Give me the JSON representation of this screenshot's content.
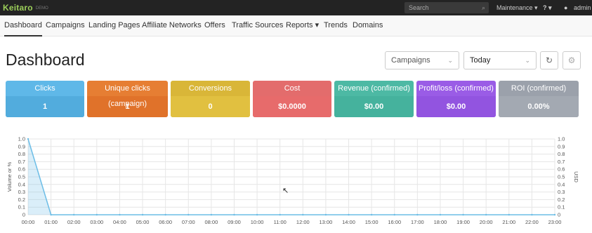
{
  "topbar": {
    "logo": "Keitaro",
    "logo_sub": "DEMO",
    "search_placeholder": "Search",
    "maintenance": "Maintenance ▾",
    "help": "? ▾",
    "user": "admin"
  },
  "nav": {
    "items": [
      "Dashboard",
      "Campaigns",
      "Landing Pages",
      "Affiliate Networks",
      "Offers",
      "Traffic Sources",
      "Reports ▾",
      "Trends",
      "Domains"
    ]
  },
  "page": {
    "title": "Dashboard",
    "filter_select": "Campaigns",
    "period_select": "Today"
  },
  "cards": [
    {
      "label": "Clicks",
      "value": "1",
      "color": "#5fb8e8",
      "val_color": "#52acdd"
    },
    {
      "label": "Unique clicks (campaign)",
      "value": "1",
      "color": "#e67e33",
      "val_color": "#e0722a"
    },
    {
      "label": "Conversions",
      "value": "0",
      "color": "#d9b638",
      "val_color": "#e1c040"
    },
    {
      "label": "Cost",
      "value": "$0.0000",
      "color": "#e36c6c",
      "val_color": "#e76b6b"
    },
    {
      "label": "Revenue (confirmed)",
      "value": "$0.00",
      "color": "#4db9a4",
      "val_color": "#45b29d"
    },
    {
      "label": "Profit/loss (confirmed)",
      "value": "$0.00",
      "color": "#9a5ce6",
      "val_color": "#9254e0"
    },
    {
      "label": "ROI (confirmed)",
      "value": "0.00%",
      "color": "#9ba1ab",
      "val_color": "#a3a9b2"
    }
  ],
  "chart_data": {
    "type": "area",
    "ylabel_left": "Volume or %",
    "ylabel_right": "USD",
    "y_ticks": [
      "0",
      "0.1",
      "0.2",
      "0.3",
      "0.4",
      "0.5",
      "0.6",
      "0.7",
      "0.8",
      "0.9",
      "1.0"
    ],
    "y_ticks_right": [
      "0",
      "0.1",
      "0.2",
      "0.3",
      "0.4",
      "0.5",
      "0.6",
      "0.7",
      "0.8",
      "0.9",
      "1.0"
    ],
    "ylim": [
      0,
      1
    ],
    "x": [
      "00:00",
      "01:00",
      "02:00",
      "03:00",
      "04:00",
      "05:00",
      "06:00",
      "07:00",
      "08:00",
      "09:00",
      "10:00",
      "11:00",
      "12:00",
      "13:00",
      "14:00",
      "15:00",
      "16:00",
      "17:00",
      "18:00",
      "19:00",
      "20:00",
      "21:00",
      "22:00",
      "23:00"
    ],
    "series": [
      {
        "values": [
          1,
          0,
          0,
          0,
          0,
          0,
          0,
          0,
          0,
          0,
          0,
          0,
          0,
          0,
          0,
          0,
          0,
          0,
          0,
          0,
          0,
          0,
          0,
          0
        ],
        "color": "#6cbde6"
      }
    ],
    "grid": true
  }
}
